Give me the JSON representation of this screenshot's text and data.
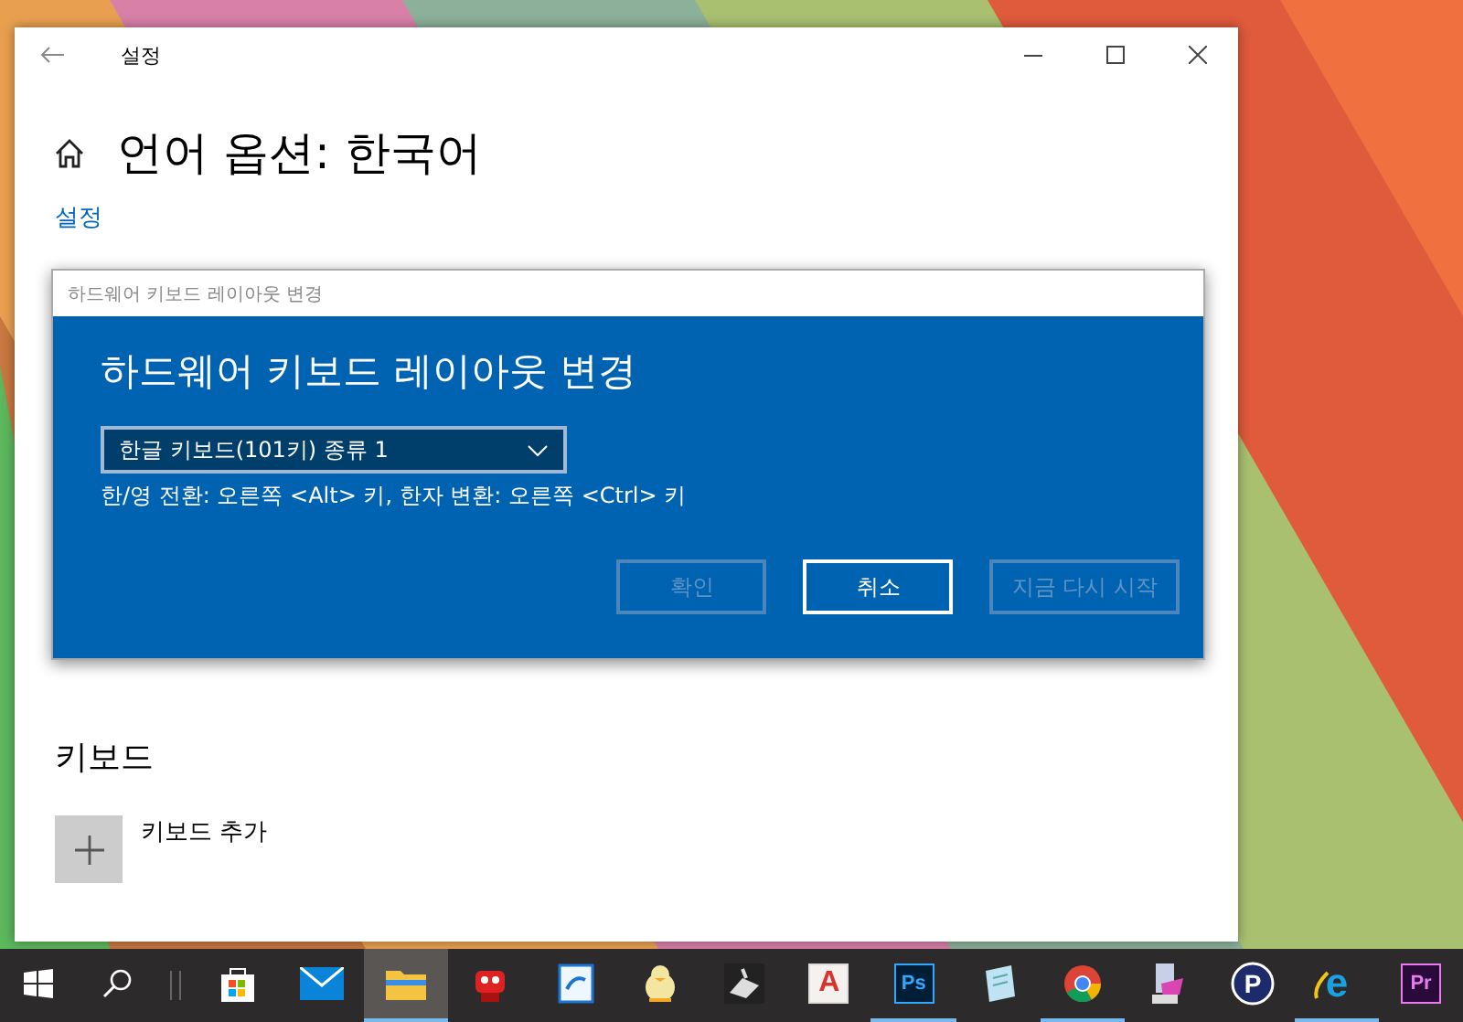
{
  "window": {
    "title": "설정",
    "heading": "언어 옵션: 한국어",
    "breadcrumb": "설정"
  },
  "keyboard_section": {
    "title": "키보드",
    "add_label": "키보드 추가"
  },
  "dialog": {
    "title": "하드웨어 키보드 레이아웃 변경",
    "heading": "하드웨어 키보드 레이아웃 변경",
    "layout_value": "한글 키보드(101키) 종류 1",
    "description": "한/영 전환: 오른쪽 <Alt> 키, 한자 변환: 오른쪽 <Ctrl> 키",
    "buttons": [
      {
        "label": "확인",
        "disabled": true,
        "focused": false
      },
      {
        "label": "취소",
        "disabled": false,
        "focused": true
      },
      {
        "label": "지금 다시 시작",
        "disabled": true,
        "focused": false
      }
    ]
  },
  "taskbar": {
    "items": [
      {
        "kind": "store",
        "running": false,
        "selected": false
      },
      {
        "kind": "mail",
        "running": false,
        "selected": false
      },
      {
        "kind": "folder",
        "running": true,
        "selected": true
      },
      {
        "kind": "robot",
        "running": false,
        "selected": false
      },
      {
        "kind": "note",
        "running": false,
        "selected": false
      },
      {
        "kind": "penguin",
        "running": false,
        "selected": false
      },
      {
        "kind": "tool",
        "running": false,
        "selected": false
      },
      {
        "kind": "letter",
        "label": "A",
        "running": false,
        "selected": false
      },
      {
        "kind": "box",
        "label": "Ps",
        "running": true,
        "selected": false
      },
      {
        "kind": "notepad",
        "running": false,
        "selected": false
      },
      {
        "kind": "wheel",
        "running": true,
        "selected": false
      },
      {
        "kind": "drive",
        "running": false,
        "selected": false
      },
      {
        "kind": "circle",
        "label": "P",
        "running": false,
        "selected": false
      },
      {
        "kind": "browser",
        "label": "e",
        "running": true,
        "selected": false
      },
      {
        "kind": "box",
        "label": "Pr",
        "running": false,
        "selected": false
      }
    ]
  }
}
